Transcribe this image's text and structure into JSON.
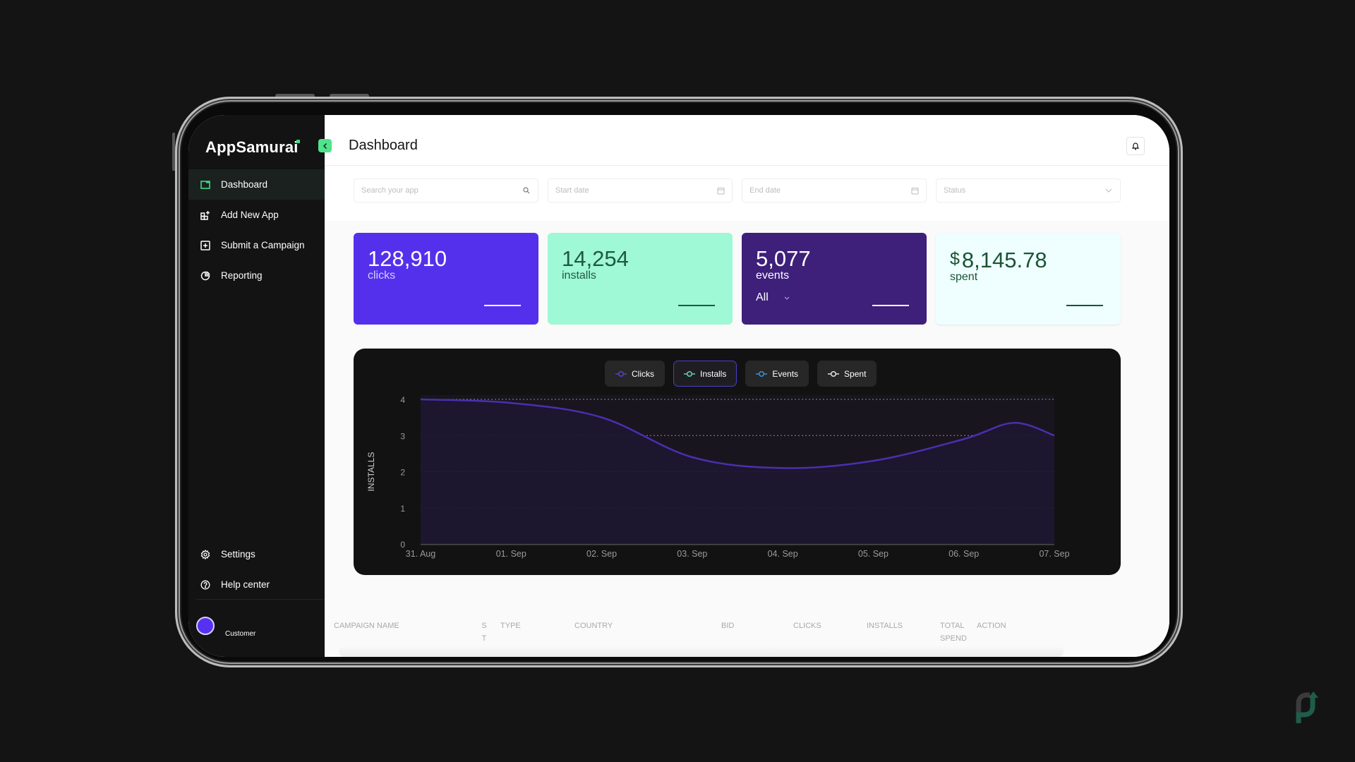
{
  "app": {
    "brand": "AppSamurai",
    "accent_color": "#4fe38b"
  },
  "sidebar": {
    "items": [
      {
        "label": "Dashboard",
        "icon": "dashboard-icon",
        "active": true
      },
      {
        "label": "Add New App",
        "icon": "add-app-icon",
        "active": false
      },
      {
        "label": "Submit a Campaign",
        "icon": "plus-square-icon",
        "active": false
      },
      {
        "label": "Reporting",
        "icon": "pie-chart-icon",
        "active": false
      }
    ],
    "bottom_items": [
      {
        "label": "Settings",
        "icon": "gear-icon"
      },
      {
        "label": "Help center",
        "icon": "help-icon"
      }
    ],
    "user": {
      "role": "Customer",
      "avatar_color": "#5632f0"
    }
  },
  "header": {
    "title": "Dashboard",
    "notification_icon": "bell-icon"
  },
  "filters": {
    "search": {
      "placeholder": "Search your app",
      "value": ""
    },
    "start_date": {
      "placeholder": "Start date",
      "value": ""
    },
    "end_date": {
      "placeholder": "End date",
      "value": ""
    },
    "status": {
      "placeholder": "Status",
      "value": ""
    }
  },
  "cards": [
    {
      "value": "128,910",
      "label": "clicks",
      "color": "#5530ec"
    },
    {
      "value": "14,254",
      "label": "installs",
      "color": "#9ff8d6"
    },
    {
      "value": "5,077",
      "label": "events",
      "color": "#3e1f7a",
      "selector": "All"
    },
    {
      "currency": "$",
      "value": "8,145.78",
      "label": "spent",
      "color": "#efffff"
    }
  ],
  "chart": {
    "legend": [
      {
        "label": "Clicks",
        "color": "#5b3fd1",
        "active": false
      },
      {
        "label": "Installs",
        "color": "#5fd3a6",
        "active": true
      },
      {
        "label": "Events",
        "color": "#3c8fd6",
        "active": false
      },
      {
        "label": "Spent",
        "color": "#e0e0e0",
        "active": false
      }
    ]
  },
  "chart_data": {
    "type": "area",
    "title": "",
    "xlabel": "",
    "ylabel": "INSTALLS",
    "x": [
      "31. Aug",
      "01. Sep",
      "02. Sep",
      "03. Sep",
      "04. Sep",
      "05. Sep",
      "06. Sep",
      "07. Sep"
    ],
    "series": [
      {
        "name": "Installs",
        "color": "#4a2fb0",
        "values": [
          4.0,
          3.9,
          3.5,
          2.4,
          2.1,
          2.3,
          2.9,
          3.0
        ]
      }
    ],
    "peak_note": "local peak ~3.35 between 06. Sep and 07. Sep",
    "ylim": [
      0,
      4
    ],
    "yticks": [
      0,
      1,
      2,
      3,
      4
    ],
    "grid": true,
    "legend_position": "top-center"
  },
  "table": {
    "columns": [
      "CAMPAIGN NAME",
      "STA",
      "TYPE",
      "COUNTRY",
      "BID",
      "CLICKS",
      "INSTALLS",
      "TOTAL SPEND",
      "ACTION"
    ]
  }
}
